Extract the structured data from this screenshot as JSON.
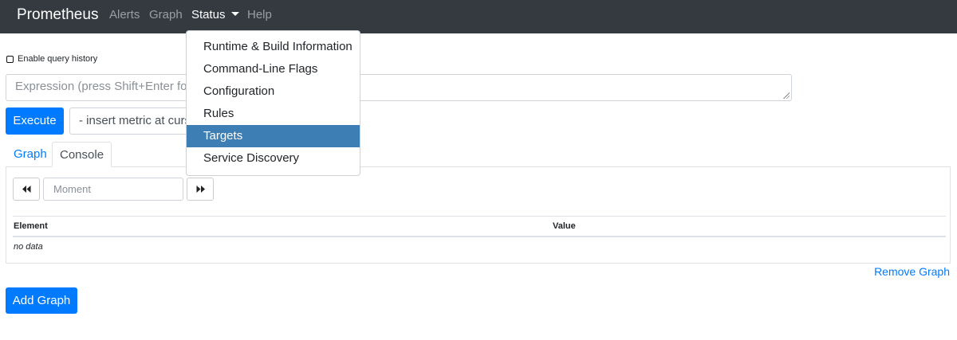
{
  "navbar": {
    "brand": "Prometheus",
    "links": [
      "Alerts",
      "Graph",
      "Status",
      "Help"
    ]
  },
  "status_menu": {
    "items": [
      "Runtime & Build Information",
      "Command-Line Flags",
      "Configuration",
      "Rules",
      "Targets",
      "Service Discovery"
    ],
    "highlighted": "Targets"
  },
  "query": {
    "history_label": "Enable query history",
    "expression_placeholder": "Expression (press Shift+Enter for n",
    "execute_label": "Execute",
    "metric_placeholder": "- insert metric at curso"
  },
  "tabs": [
    "Graph",
    "Console"
  ],
  "console": {
    "moment_placeholder": "Moment",
    "columns": [
      "Element",
      "Value"
    ],
    "empty_text": "no data"
  },
  "remove_graph_label": "Remove Graph",
  "add_graph_label": "Add Graph",
  "colors": {
    "navbar_bg": "#343a40",
    "primary": "#007bff",
    "menu_highlight": "#3d7fb4"
  }
}
